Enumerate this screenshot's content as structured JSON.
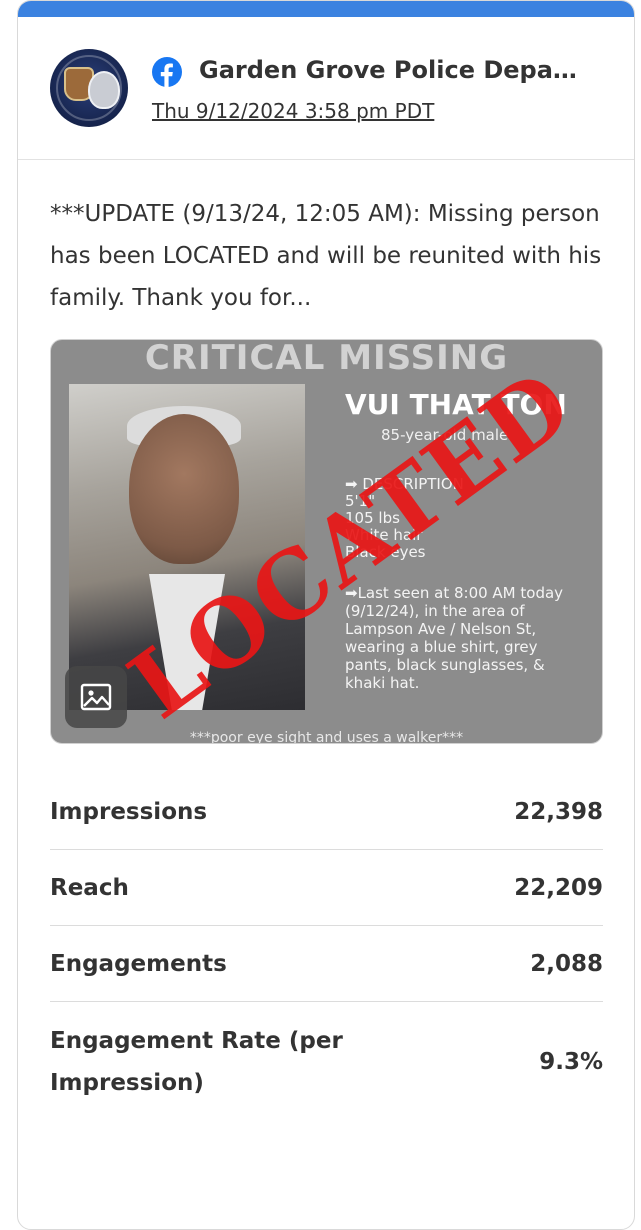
{
  "header": {
    "page_name": "Garden Grove Police Depa…",
    "timestamp": "Thu 9/12/2024 3:58 pm PDT",
    "icons": {
      "platform": "facebook-icon",
      "avatar": "police-badge-avatar"
    },
    "accent_color": "#3b82e0",
    "facebook_color": "#1877f2"
  },
  "post": {
    "text": "***UPDATE (9/13/24, 12:05 AM): Missing person has been LOCATED and will be reunited with his family. Thank you for..."
  },
  "media": {
    "poster_title": "CRITICAL MISSING",
    "poster_name": "VUI THAT TON",
    "poster_subtitle": "85-year-old male",
    "poster_description": "➡ DESCRIPTION\n5'1\"\n105 lbs\nWhite hair\nBlack eyes",
    "poster_last_seen": "➡Last seen at 8:00 AM today (9/12/24), in the area of Lampson Ave / Nelson St, wearing a blue shirt, grey pants, black sunglasses, & khaki hat.",
    "poster_footer": "***poor eye sight and uses a walker***",
    "stamp_text": "LOCATED",
    "stamp_color": "#e81616",
    "media_icon": "image-icon"
  },
  "metrics": [
    {
      "label": "Impressions",
      "value": "22,398"
    },
    {
      "label": "Reach",
      "value": "22,209"
    },
    {
      "label": "Engagements",
      "value": "2,088"
    },
    {
      "label": "Engagement Rate (per Impression)",
      "value": "9.3%"
    }
  ]
}
